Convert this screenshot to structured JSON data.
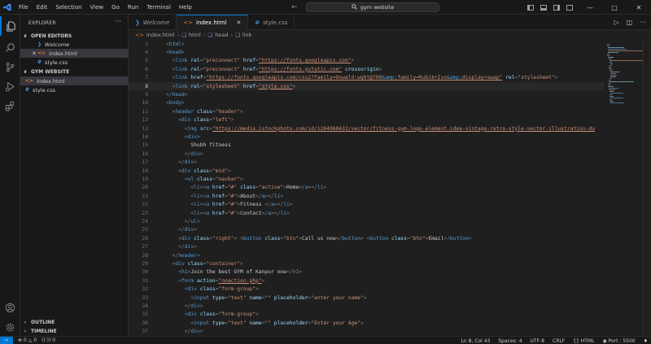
{
  "menu": [
    "File",
    "Edit",
    "Selection",
    "View",
    "Go",
    "Run",
    "Terminal",
    "Help"
  ],
  "search": {
    "text": "gym website"
  },
  "sidebar": {
    "title": "EXPLORER",
    "open_editors_label": "OPEN EDITORS",
    "open_editors": [
      {
        "name": "Welcome",
        "icon": "vscode-logo-icon",
        "italic": true
      },
      {
        "name": "index.html",
        "icon": "html-file-icon",
        "italic": false,
        "selected": true
      },
      {
        "name": "style.css",
        "icon": "css-file-icon",
        "italic": false
      }
    ],
    "folder_label": "GYM WEBSITE",
    "files": [
      {
        "name": "index.html",
        "icon": "html-file-icon",
        "selected": true
      },
      {
        "name": "style.css",
        "icon": "css-file-icon"
      }
    ],
    "outline_label": "OUTLINE",
    "timeline_label": "TIMELINE"
  },
  "tabs": [
    {
      "label": "Welcome",
      "active": false
    },
    {
      "label": "index.html",
      "active": true
    },
    {
      "label": "style.css",
      "active": false
    }
  ],
  "breadcrumb": [
    "index.html",
    "html",
    "head",
    "link"
  ],
  "editor": {
    "current_line": 8,
    "lines": [
      {
        "n": "3",
        "text": "<html>"
      },
      {
        "n": "4",
        "text": "<head>"
      },
      {
        "n": "5",
        "text": "  <link rel=\"preconnect\" href=\"https://fonts.googleapis.com\">"
      },
      {
        "n": "6",
        "text": "  <link rel=\"preconnect\" href=\"https://fonts.gstatic.com\" crossorigin>"
      },
      {
        "n": "7",
        "text": "  <link href=\"https://fonts.googleapis.com/css2?family=Oswald:wght@700&amp;family=Rubik+Iso&amp;display=swap\" rel=\"stylesheet\">"
      },
      {
        "n": "8",
        "text": "  <link rel=\"stylesheet\" href=\"style.css\">"
      },
      {
        "n": "9",
        "text": "</head>"
      },
      {
        "n": "10",
        "text": "<body>"
      },
      {
        "n": "11",
        "text": "  <header class=\"header\">"
      },
      {
        "n": "12",
        "text": "    <div class=\"left\">"
      },
      {
        "n": "13",
        "text": "      <img src=\"https://media.istockphoto.com/id/1264068432/vector/fitness-gym-logo-element-idea-vintage-retro-style-vector-illustration-du"
      },
      {
        "n": "14",
        "text": "      <div>"
      },
      {
        "n": "15",
        "text": "        Shubh fitness"
      },
      {
        "n": "16",
        "text": "      </div>"
      },
      {
        "n": "17",
        "text": "    </div>"
      },
      {
        "n": "18",
        "text": "    <div class=\"mid\">"
      },
      {
        "n": "19",
        "text": "      <ul class=\"navbar\">"
      },
      {
        "n": "20",
        "text": "        <li><a href=\"#\" class=\"active\">Home</a></li>"
      },
      {
        "n": "21",
        "text": "        <li><a href=\"#\">About</a></li>"
      },
      {
        "n": "22",
        "text": "        <li><a href=\"#\">Fitness </a></li>"
      },
      {
        "n": "23",
        "text": "        <li><a href=\"#\">Contact</a></li>"
      },
      {
        "n": "24",
        "text": "      </ul>"
      },
      {
        "n": "25",
        "text": "    </div>"
      },
      {
        "n": "26",
        "text": "    <div class=\"right\"> <button class=\"btn\">Call us now</button> <button class=\"btn\">Email</button>"
      },
      {
        "n": "27",
        "text": "    </div>"
      },
      {
        "n": "28",
        "text": "  </header>"
      },
      {
        "n": "29",
        "text": "  <div class=\"container\">"
      },
      {
        "n": "30",
        "text": "    <h1>Join the best GYM of Kanpur now</h1>"
      },
      {
        "n": "31",
        "text": "    <form action=\"noaction.php\">"
      },
      {
        "n": "32",
        "text": "      <div class=\"form-group\">"
      },
      {
        "n": "33",
        "text": "        <input type=\"text\" name=\"\" placeholder=\"enter your name\">"
      },
      {
        "n": "34",
        "text": "      </div>"
      },
      {
        "n": "35",
        "text": "      <div class=\"form-group\">"
      },
      {
        "n": "36",
        "text": "        <input type=\"text\" name=\"\" placeholder=\"Enter your Age\">"
      },
      {
        "n": "37",
        "text": "      </div>"
      },
      {
        "n": "38",
        "text": "      <div class=\"form-group\">"
      },
      {
        "n": "39",
        "text": "        <input type=\"text\" name=\"\" placeholder=\"enter your gender\">"
      }
    ]
  },
  "status": {
    "errors": "0",
    "warnings": "0",
    "ports": "0",
    "position": "Ln 8, Col 43",
    "spaces": "Spaces: 4",
    "encoding": "UTF-8",
    "eol": "CRLF",
    "language": "HTML",
    "port": "Port : 5500"
  },
  "colors": {
    "accent": "#0078d4",
    "background": "#1f1f1f",
    "tag": "#569cd6",
    "attribute": "#9cdcfe",
    "string": "#ce9178"
  }
}
